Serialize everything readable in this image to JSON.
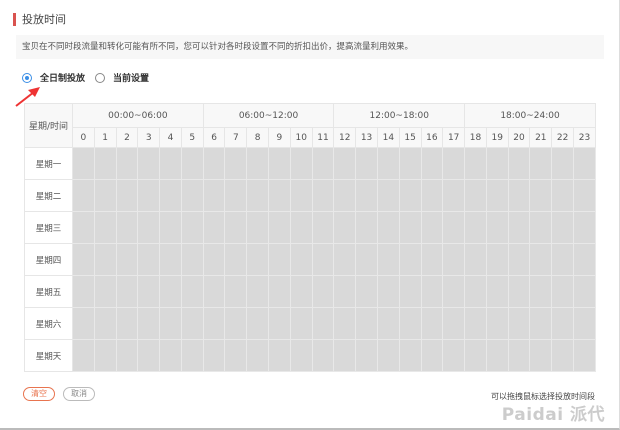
{
  "title": "投放时间",
  "tip": "宝贝在不同时段流量和转化可能有所不同，您可以针对各时段设置不同的折扣出价，提高流量利用效果。",
  "radios": [
    {
      "label": "全日制投放",
      "checked": true
    },
    {
      "label": "当前设置",
      "checked": false
    }
  ],
  "table": {
    "corner": "星期/时间",
    "ranges": [
      "00:00~06:00",
      "06:00~12:00",
      "12:00~18:00",
      "18:00~24:00"
    ],
    "hours": [
      "0",
      "1",
      "2",
      "3",
      "4",
      "5",
      "6",
      "7",
      "8",
      "9",
      "10",
      "11",
      "12",
      "13",
      "14",
      "15",
      "16",
      "17",
      "18",
      "19",
      "20",
      "21",
      "22",
      "23"
    ],
    "days": [
      "星期一",
      "星期二",
      "星期三",
      "星期四",
      "星期五",
      "星期六",
      "星期天"
    ]
  },
  "buttons": {
    "clear": "清空",
    "cancel": "取消"
  },
  "hint": "可以拖拽鼠标选择投放时间段",
  "watermark": "Paidai派代",
  "colors": {
    "accent": "#d9534f",
    "radio": "#3a8ee6",
    "cell": "#d9d9d9"
  }
}
